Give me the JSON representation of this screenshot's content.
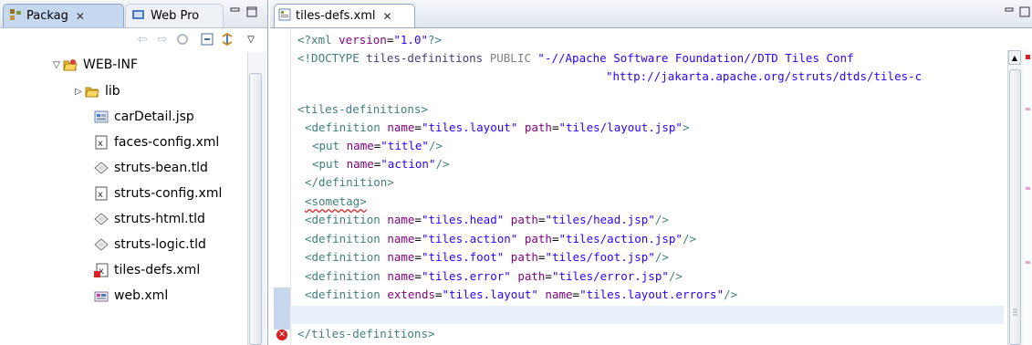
{
  "left_panel": {
    "tabs": [
      {
        "label": "Packag",
        "active": true,
        "icon": "package-explorer-icon"
      },
      {
        "label": "Web Pro",
        "active": false,
        "icon": "web-projects-icon"
      }
    ],
    "minmax": "▭ ▢",
    "toolbar_icons": [
      "back-arrow-icon",
      "forward-arrow-icon",
      "up-icon",
      "collapse-all-icon",
      "link-with-editor-icon",
      "view-menu-icon"
    ],
    "tree": {
      "folder": {
        "label": "WEB-INF",
        "expanded": true
      },
      "items": [
        {
          "label": "lib",
          "type": "folder"
        },
        {
          "label": "carDetail.jsp",
          "type": "jsp"
        },
        {
          "label": "faces-config.xml",
          "type": "xml"
        },
        {
          "label": "struts-bean.tld",
          "type": "tld"
        },
        {
          "label": "struts-config.xml",
          "type": "xml"
        },
        {
          "label": "struts-html.tld",
          "type": "tld"
        },
        {
          "label": "struts-logic.tld",
          "type": "tld"
        },
        {
          "label": "tiles-defs.xml",
          "type": "xml-error"
        },
        {
          "label": "web.xml",
          "type": "webxml"
        }
      ]
    }
  },
  "editor": {
    "tab": {
      "label": "tiles-defs.xml",
      "icon": "xml-file-icon"
    },
    "code": {
      "l1": {
        "a": "<?xml ",
        "b": "version",
        "c": "=",
        "d": "\"1.0\"",
        "e": "?>"
      },
      "l2": {
        "a": "<!DOCTYPE ",
        "b": "tiles-definitions ",
        "c": "PUBLIC ",
        "d": "\"-//Apache Software Foundation//DTD Tiles Conf"
      },
      "l3": {
        "a": "\"http://jakarta.apache.org/struts/dtds/tiles-c"
      },
      "l4": {
        "a": "<tiles-definitions>"
      },
      "l5": {
        "a": "<definition ",
        "b": "name",
        "c": "=",
        "d": "\"tiles.layout\" ",
        "e": "path",
        "f": "=",
        "g": "\"tiles/layout.jsp\"",
        "h": ">"
      },
      "l6": {
        "a": "<put ",
        "b": "name",
        "c": "=",
        "d": "\"title\"",
        "e": "/>"
      },
      "l7": {
        "a": "<put ",
        "b": "name",
        "c": "=",
        "d": "\"action\"",
        "e": "/>"
      },
      "l8": {
        "a": "</definition>"
      },
      "l9": {
        "a": "<sometag>"
      },
      "l10": {
        "a": "<definition ",
        "b": "name",
        "c": "=",
        "d": "\"tiles.head\" ",
        "e": "path",
        "f": "=",
        "g": "\"tiles/head.jsp\"",
        "h": "/>"
      },
      "l11": {
        "a": "<definition ",
        "b": "name",
        "c": "=",
        "d": "\"tiles.action\" ",
        "e": "path",
        "f": "=",
        "g": "\"tiles/action.jsp\"",
        "h": "/>"
      },
      "l12": {
        "a": "<definition ",
        "b": "name",
        "c": "=",
        "d": "\"tiles.foot\" ",
        "e": "path",
        "f": "=",
        "g": "\"tiles/foot.jsp\"",
        "h": "/>"
      },
      "l13": {
        "a": "<definition ",
        "b": "name",
        "c": "=",
        "d": "\"tiles.error\" ",
        "e": "path",
        "f": "=",
        "g": "\"tiles/error.jsp\"",
        "h": "/>"
      },
      "l14": {
        "a": "<definition ",
        "b": "extends",
        "c": "=",
        "d": "\"tiles.layout\" ",
        "e": "name",
        "f": "=",
        "g": "\"tiles.layout.errors\"",
        "h": "/>"
      },
      "l16": {
        "a": "</tiles-definitions>"
      }
    }
  },
  "colors": {
    "tag": "#3f7f7f",
    "attribute": "#7f007f",
    "value": "#2a00ff",
    "error": "#d82020"
  }
}
